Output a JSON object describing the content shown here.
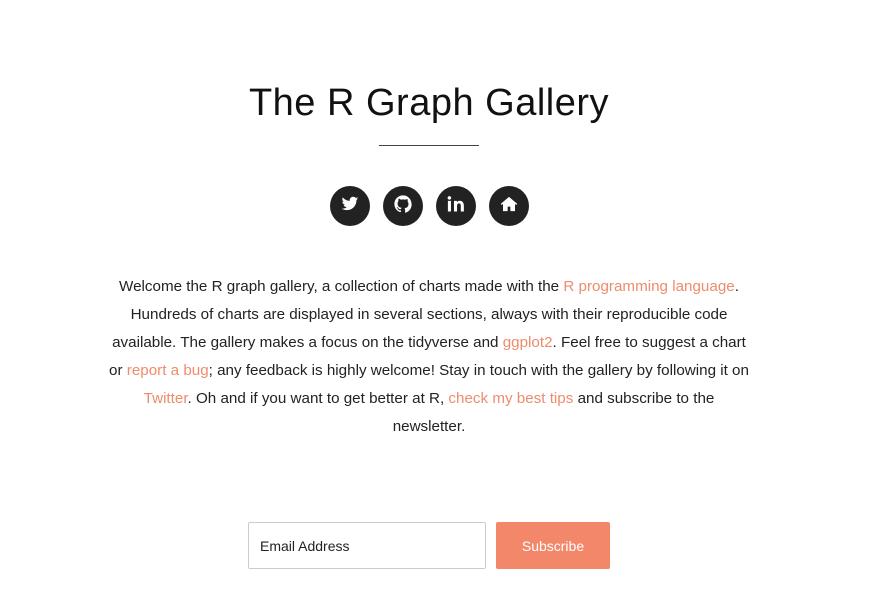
{
  "header": {
    "title": "The R Graph Gallery"
  },
  "social": [
    {
      "name": "twitter",
      "icon": "twitter-icon"
    },
    {
      "name": "github",
      "icon": "github-icon"
    },
    {
      "name": "linkedin",
      "icon": "linkedin-icon"
    },
    {
      "name": "home",
      "icon": "home-icon"
    }
  ],
  "intro": {
    "t1": "Welcome the R graph gallery, a collection of charts made with the ",
    "link_r": "R programming language",
    "t2": ". Hundreds of charts are displayed in several sections, always with their reproducible code available. The gallery makes a focus on the tidyverse and ",
    "link_ggplot": "ggplot2",
    "t3": ". Feel free to suggest a chart or ",
    "link_bug": "report a bug",
    "t4": "; any feedback is highly welcome! Stay in touch with the gallery by following it on ",
    "link_twitter": "Twitter",
    "t5": ". Oh and if you want to get better at R, ",
    "link_tips": "check my best tips",
    "t6": " and subscribe to the newsletter."
  },
  "newsletter": {
    "email_placeholder": "Email Address",
    "email_value": "",
    "button_label": "Subscribe"
  },
  "colors": {
    "accent": "#f2876a",
    "link": "#ee8c6c",
    "icon_bg": "#222222"
  }
}
